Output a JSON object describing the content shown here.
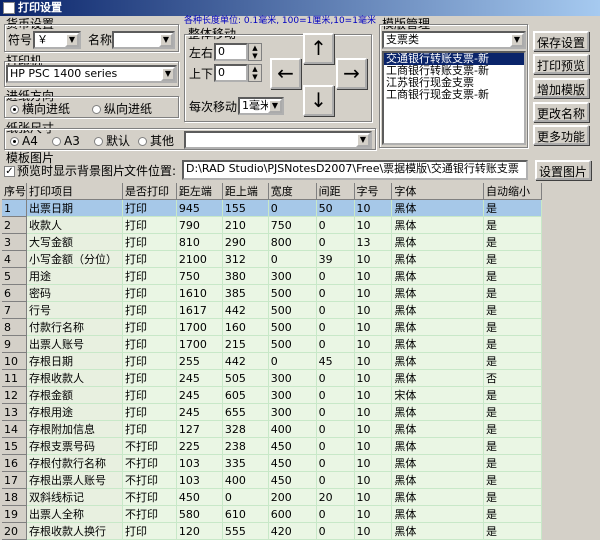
{
  "window": {
    "title": "打印设置"
  },
  "currency": {
    "group_label": "货币设置",
    "symbol_label": "符号",
    "symbol_value": "￥",
    "name_label": "名称",
    "name_value": ""
  },
  "units_note": "各种长度单位: 0.1毫米, 100=1厘米,10=1毫米",
  "move": {
    "group_label": "整体移动",
    "left_right_label": "左右",
    "left_right_value": "0",
    "up_down_label": "上下",
    "up_down_value": "0",
    "step_label": "每次移动",
    "step_value": "1毫米"
  },
  "printer": {
    "group_label": "打印机",
    "value": "HP PSC 1400 series"
  },
  "feed": {
    "group_label": "进纸方向",
    "options": [
      "横向进纸",
      "纵向进纸"
    ],
    "selected": 0
  },
  "paper": {
    "group_label": "纸张尺寸",
    "options": [
      "A4",
      "A3",
      "默认",
      "其他"
    ],
    "selected": 0,
    "other_value": ""
  },
  "template_group": {
    "group_label": "模版管理",
    "category_value": "支票类",
    "items": [
      "交通银行转账支票-新",
      "工商银行转账支票-新",
      "江苏银行现金支票",
      "工商银行现金支票-新"
    ],
    "selected": 0
  },
  "buttons": {
    "save": "保存设置",
    "preview": "打印预览",
    "add": "增加模版",
    "rename": "更改名称",
    "more": "更多功能",
    "set_image": "设置图片"
  },
  "template_image": {
    "group_label": "模板图片",
    "preview_bg_label": "预览时显示背景图片",
    "preview_bg_checked": true,
    "file_label": "文件位置:",
    "file_path": "D:\\RAD Studio\\PJSNotesD2007\\Free\\票据模版\\交通银行转账支票"
  },
  "grid": {
    "headers": [
      "序号",
      "打印项目",
      "是否打印",
      "距左端",
      "距上端",
      "宽度",
      "间距",
      "字号",
      "字体",
      "自动缩小"
    ],
    "rows": [
      [
        "1",
        "出票日期",
        "打印",
        "945",
        "155",
        "0",
        "50",
        "10",
        "黑体",
        "是"
      ],
      [
        "2",
        "收款人",
        "打印",
        "790",
        "210",
        "750",
        "0",
        "10",
        "黑体",
        "是"
      ],
      [
        "3",
        "大写金额",
        "打印",
        "810",
        "290",
        "800",
        "0",
        "13",
        "黑体",
        "是"
      ],
      [
        "4",
        "小写金额（分位）",
        "打印",
        "2100",
        "312",
        "0",
        "39",
        "10",
        "黑体",
        "是"
      ],
      [
        "5",
        "用途",
        "打印",
        "750",
        "380",
        "300",
        "0",
        "10",
        "黑体",
        "是"
      ],
      [
        "6",
        "密码",
        "打印",
        "1610",
        "385",
        "500",
        "0",
        "10",
        "黑体",
        "是"
      ],
      [
        "7",
        "行号",
        "打印",
        "1617",
        "442",
        "500",
        "0",
        "10",
        "黑体",
        "是"
      ],
      [
        "8",
        "付款行名称",
        "打印",
        "1700",
        "160",
        "500",
        "0",
        "10",
        "黑体",
        "是"
      ],
      [
        "9",
        "出票人账号",
        "打印",
        "1700",
        "215",
        "500",
        "0",
        "10",
        "黑体",
        "是"
      ],
      [
        "10",
        "存根日期",
        "打印",
        "255",
        "442",
        "0",
        "45",
        "10",
        "黑体",
        "是"
      ],
      [
        "11",
        "存根收款人",
        "打印",
        "245",
        "505",
        "300",
        "0",
        "10",
        "黑体",
        "否"
      ],
      [
        "12",
        "存根金额",
        "打印",
        "245",
        "605",
        "300",
        "0",
        "10",
        "宋体",
        "是"
      ],
      [
        "13",
        "存根用途",
        "打印",
        "245",
        "655",
        "300",
        "0",
        "10",
        "黑体",
        "是"
      ],
      [
        "14",
        "存根附加信息",
        "打印",
        "127",
        "328",
        "400",
        "0",
        "10",
        "黑体",
        "是"
      ],
      [
        "15",
        "存根支票号码",
        "不打印",
        "225",
        "238",
        "450",
        "0",
        "10",
        "黑体",
        "是"
      ],
      [
        "16",
        "存根付款行名称",
        "不打印",
        "103",
        "335",
        "450",
        "0",
        "10",
        "黑体",
        "是"
      ],
      [
        "17",
        "存根出票人账号",
        "不打印",
        "103",
        "400",
        "450",
        "0",
        "10",
        "黑体",
        "是"
      ],
      [
        "18",
        "双斜线标记",
        "不打印",
        "450",
        "0",
        "200",
        "20",
        "10",
        "黑体",
        "是"
      ],
      [
        "19",
        "出票人全称",
        "不打印",
        "580",
        "610",
        "600",
        "0",
        "10",
        "黑体",
        "是"
      ],
      [
        "20",
        "存根收款人换行",
        "打印",
        "120",
        "555",
        "420",
        "0",
        "10",
        "黑体",
        "是"
      ]
    ],
    "selected_row": 0
  }
}
